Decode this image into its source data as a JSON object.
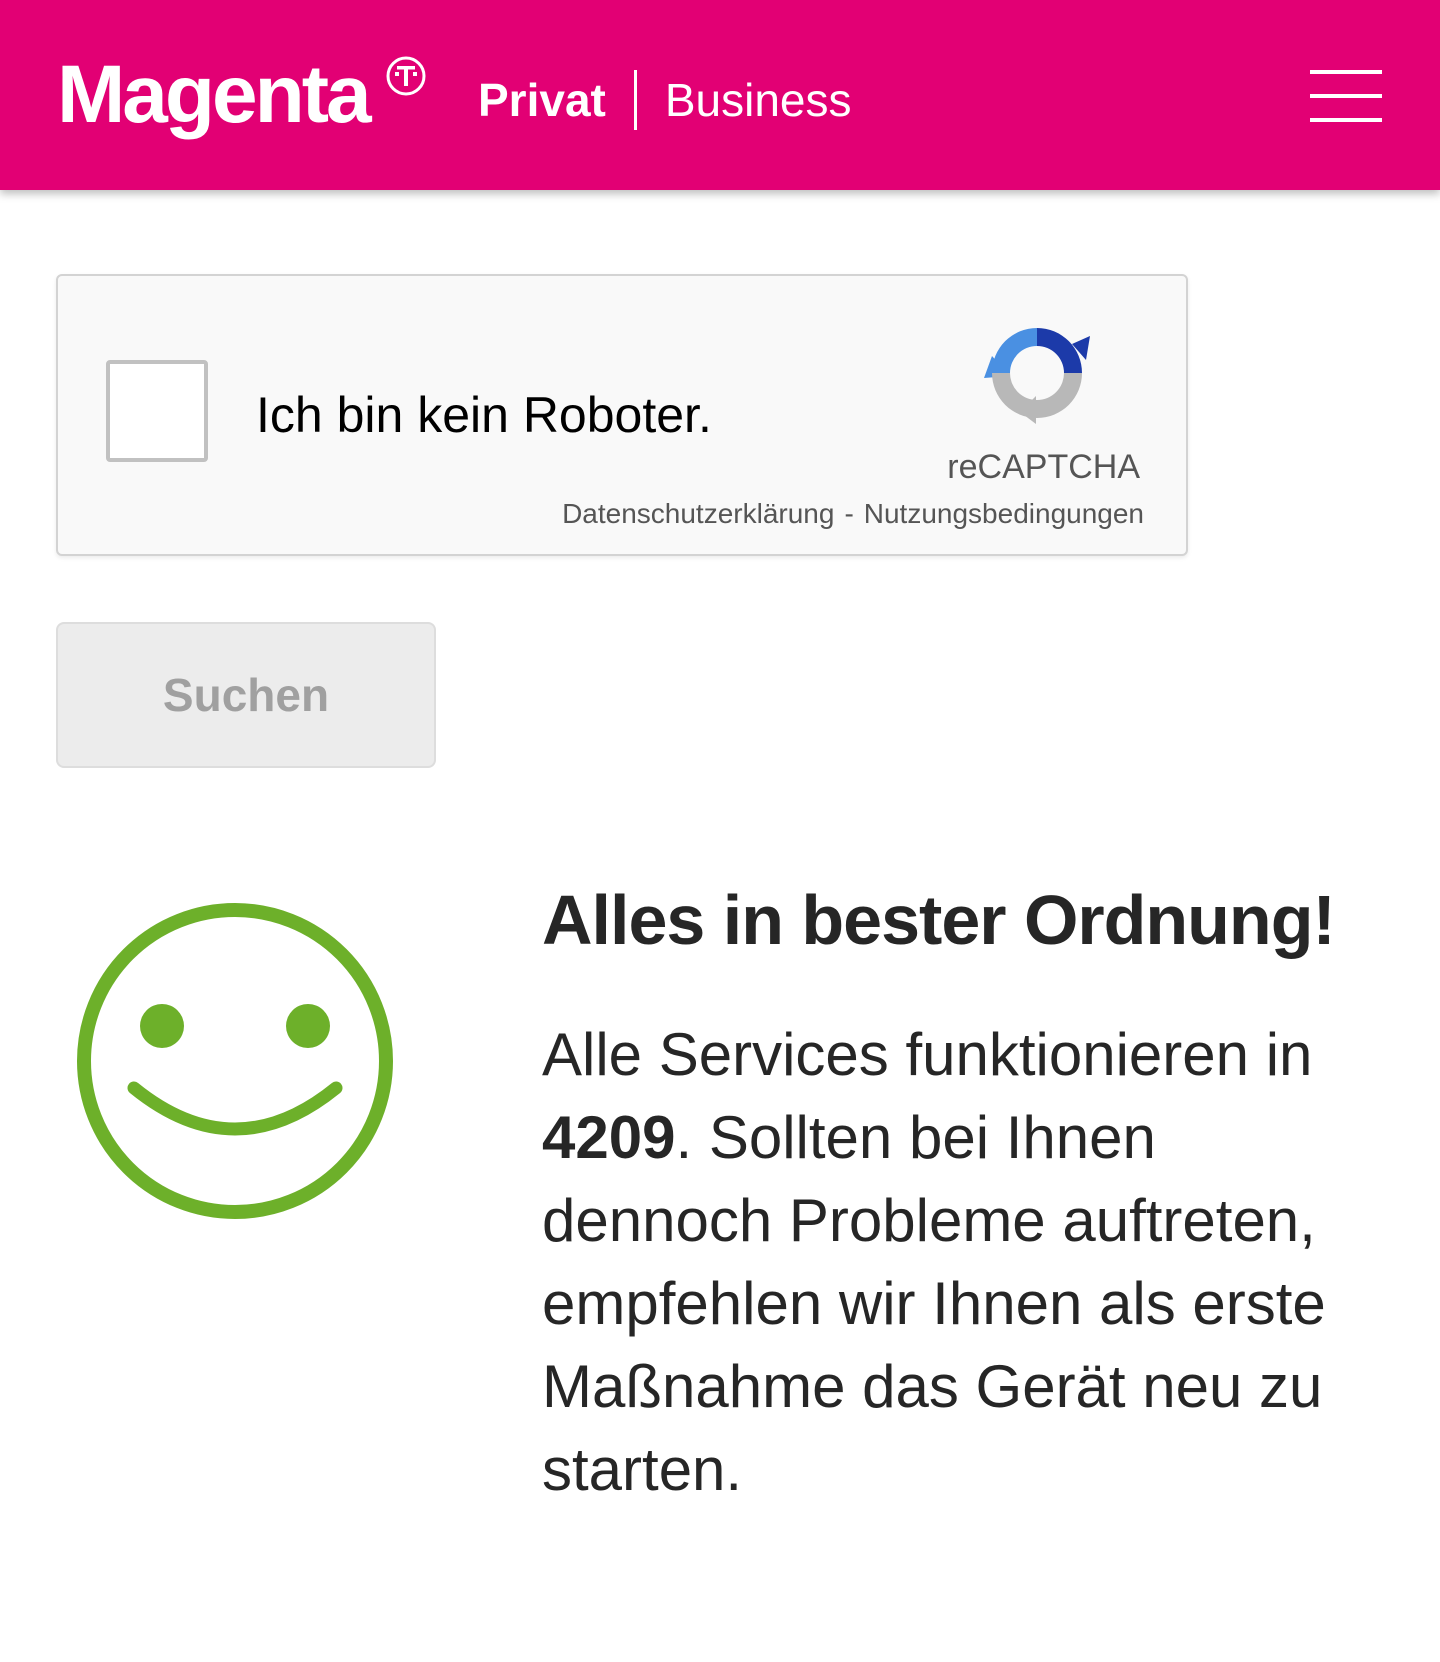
{
  "header": {
    "logo_text": "Magenta",
    "logo_mark_icon": "telekom-t-icon",
    "nav_privat": "Privat",
    "nav_business": "Business",
    "menu_icon": "hamburger-menu-icon",
    "brand_color": "#e20074"
  },
  "captcha": {
    "label": "Ich bin kein Roboter.",
    "brand": "reCAPTCHA",
    "privacy_link": "Datenschutzerklärung",
    "separator": "-",
    "terms_link": "Nutzungsbedingungen",
    "logo_icon": "recaptcha-logo-icon",
    "checked": false
  },
  "search": {
    "button_label": "Suchen",
    "disabled": true
  },
  "status": {
    "icon": "smiley-face-icon",
    "icon_color": "#6db02a",
    "title": "Alles in bester Ordnung!",
    "text_before": "Alle Services funktionieren in ",
    "postal_code": "4209",
    "text_after": ". Sollten bei Ihnen dennoch Probleme auftreten, empfehlen wir Ihnen als erste Maßnahme das Gerät neu zu starten."
  }
}
